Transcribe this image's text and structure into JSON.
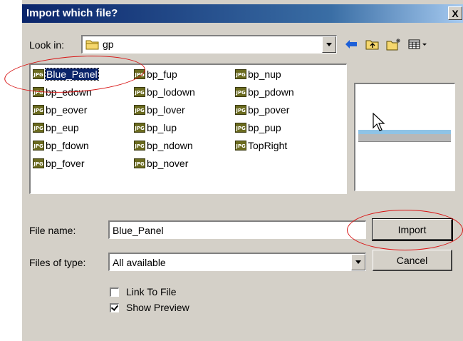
{
  "dialog": {
    "title": "Import which file?",
    "close_glyph": "X"
  },
  "look_in": {
    "label": "Look in:",
    "value": "gp",
    "icon": "folder-icon"
  },
  "toolbar": {
    "icons": [
      "back-arrow-icon",
      "up-folder-icon",
      "new-folder-icon",
      "view-menu-icon"
    ]
  },
  "files": [
    {
      "name": "Blue_Panel",
      "selected": true
    },
    {
      "name": "bp_edown"
    },
    {
      "name": "bp_eover"
    },
    {
      "name": "bp_eup"
    },
    {
      "name": "bp_fdown"
    },
    {
      "name": "bp_fover"
    },
    {
      "name": "bp_fup"
    },
    {
      "name": "bp_lodown"
    },
    {
      "name": "bp_lover"
    },
    {
      "name": "bp_lup"
    },
    {
      "name": "bp_ndown"
    },
    {
      "name": "bp_nover"
    },
    {
      "name": "bp_nup"
    },
    {
      "name": "bp_pdown"
    },
    {
      "name": "bp_pover"
    },
    {
      "name": "bp_pup"
    },
    {
      "name": "TopRight"
    }
  ],
  "file_icon_text": "JPG",
  "file_name": {
    "label": "File name:",
    "value": "Blue_Panel"
  },
  "files_of_type": {
    "label": "Files of type:",
    "value": "All available"
  },
  "buttons": {
    "import": "Import",
    "cancel": "Cancel"
  },
  "options": {
    "link_to_file": {
      "label": "Link To File",
      "checked": false
    },
    "show_preview": {
      "label": "Show Preview",
      "checked": true
    }
  },
  "colors": {
    "annotation": "#d81414",
    "selection": "#0a246a",
    "titlebar": "#0a246a"
  }
}
